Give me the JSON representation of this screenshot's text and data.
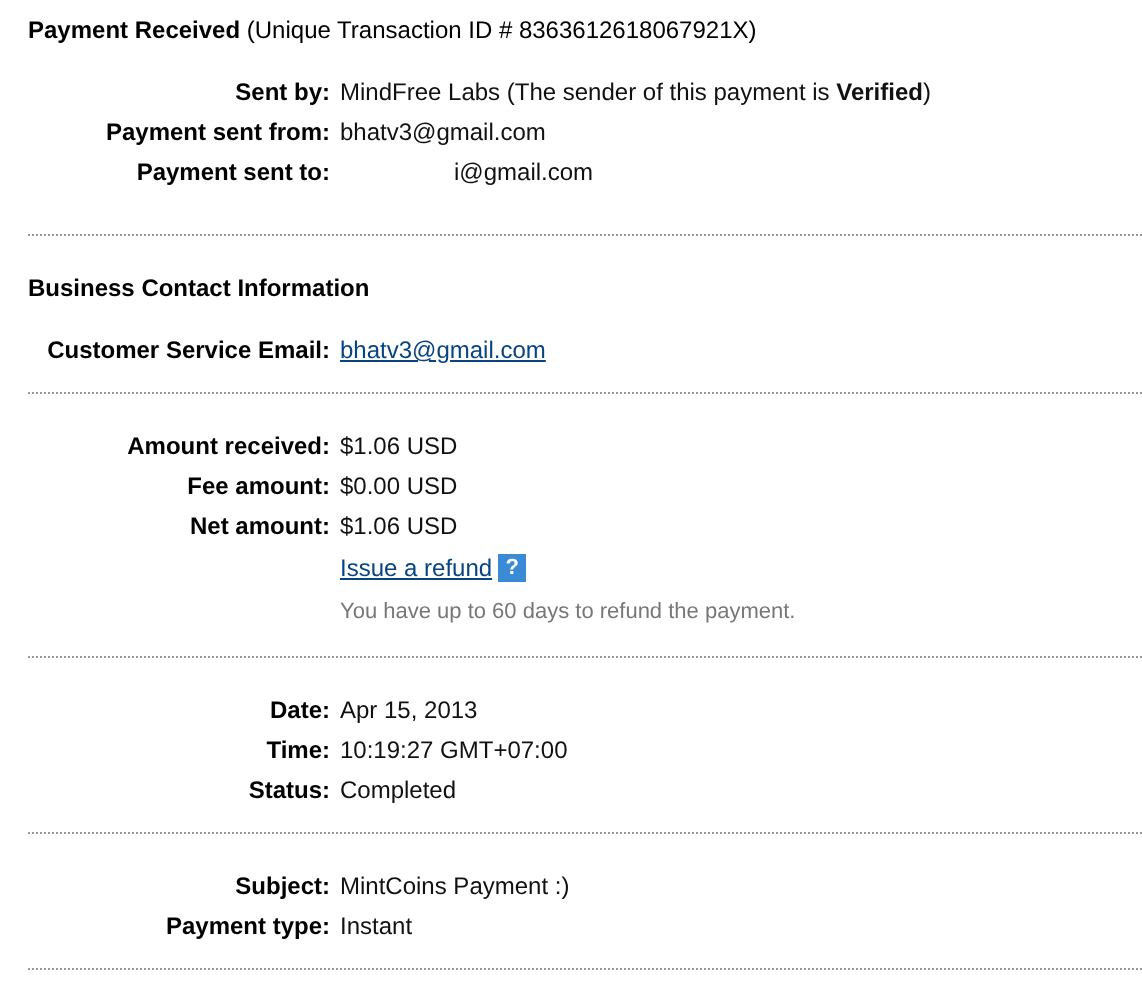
{
  "title": "**Payment Received** (Unique Transaction ID # 8363612618067921X)",
  "sections": [
    {
      "rows": [
        {
          "kind": "text",
          "label": "Sent by:",
          "value": "MindFree Labs (The sender of this payment is **Verified**)"
        },
        {
          "kind": "text",
          "label": "Payment sent from:",
          "value": "bhatv3@gmail.com"
        },
        {
          "kind": "redacted",
          "label": "Payment sent to:",
          "value": "i@gmail.com"
        }
      ]
    },
    {
      "heading": "Business Contact Information",
      "rows": [
        {
          "kind": "link",
          "label": "Customer Service Email:",
          "value": "bhatv3@gmail.com"
        }
      ]
    },
    {
      "rows": [
        {
          "kind": "text",
          "label": "Amount received:",
          "value": "$1.06 USD"
        },
        {
          "kind": "text",
          "label": "Fee amount:",
          "value": "$0.00 USD"
        },
        {
          "kind": "text",
          "label": "Net amount:",
          "value": "$1.06 USD"
        },
        {
          "kind": "refund",
          "value": "Issue a refund",
          "help": "?"
        },
        {
          "kind": "note",
          "value": "You have up to 60 days to refund the payment."
        }
      ]
    },
    {
      "rows": [
        {
          "kind": "text",
          "label": "Date:",
          "value": "Apr 15, 2013"
        },
        {
          "kind": "text",
          "label": "Time:",
          "value": "10:19:27 GMT+07:00"
        },
        {
          "kind": "text",
          "label": "Status:",
          "value": "Completed"
        }
      ]
    },
    {
      "rows": [
        {
          "kind": "text",
          "label": "Subject:",
          "value": "MintCoins Payment :)"
        },
        {
          "kind": "text",
          "label": "Payment type:",
          "value": "Instant"
        }
      ]
    }
  ]
}
